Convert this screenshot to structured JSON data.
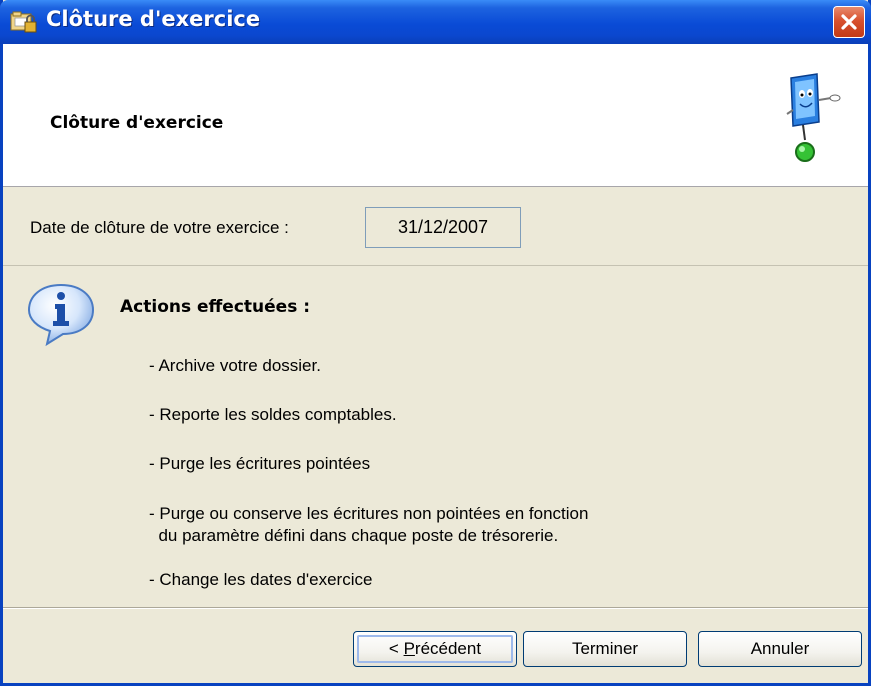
{
  "window": {
    "title": "Clôture d'exercice",
    "title_icon": "lock-folder-icon",
    "close_icon": "close-icon"
  },
  "header": {
    "title": "Clôture d'exercice",
    "mascot_icon": "computer-mascot-icon"
  },
  "closing_date": {
    "label": "Date de clôture de votre exercice :",
    "value": "31/12/2007"
  },
  "actions": {
    "icon": "info-icon",
    "title": "Actions effectuées :",
    "items": [
      "- Archive votre dossier.",
      "- Reporte les soldes comptables.",
      "- Purge les écritures pointées",
      "- Purge ou conserve les écritures non pointées en fonction\n  du paramètre défini dans chaque poste de trésorerie.",
      "- Change les dates d'exercice"
    ]
  },
  "buttons": {
    "previous_prefix": "< ",
    "previous_accel": "P",
    "previous_rest": "récédent",
    "finish": "Terminer",
    "cancel": "Annuler"
  },
  "colors": {
    "titlebar": "#0a4bd6",
    "close": "#d8512f",
    "dialog_bg": "#ece9d8"
  }
}
